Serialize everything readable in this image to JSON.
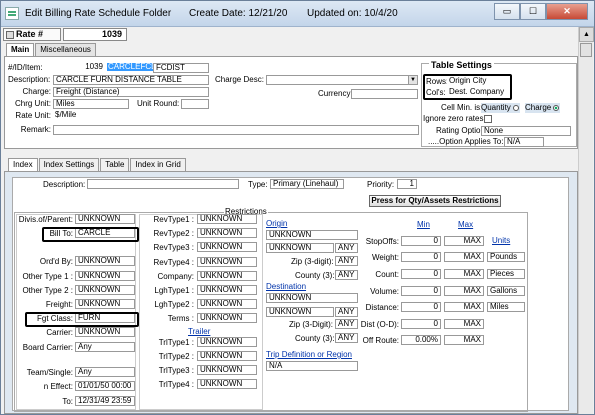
{
  "window": {
    "title": "Edit Billing Rate Schedule Folder",
    "created": "Create Date: 12/21/20",
    "updated": "Updated on: 10/4/20",
    "btn_min": "▭",
    "btn_max": "☐",
    "btn_close": "✕"
  },
  "rate": {
    "label": "Rate #",
    "value": "1039"
  },
  "top_tabs": [
    "Main",
    "Miscellaneous"
  ],
  "main": {
    "id_label": "#/ID/Item:",
    "id_num": "1039",
    "id_code": "CARCLEFCDS",
    "id_item": "FCDIST",
    "desc_label": "Description:",
    "desc_value": "CARCLE FURN DISTANCE TABLE",
    "charge_label": "Charge:",
    "charge_value": "Freight (Distance)",
    "chrg_unit_label": "Chrg Unit:",
    "chrg_unit_value": "Miles",
    "unit_round_label": "Unit Round:",
    "rate_unit_label": "Rate Unit:",
    "rate_unit_value": "$/Mile",
    "remark_label": "Remark:",
    "charge_desc_label": "Charge Desc:",
    "currency_label": "Currency:"
  },
  "table_settings": {
    "title": "Table Settings",
    "rows_label": "Rows:",
    "rows_value": "Origin City",
    "cols_label": "Col's:",
    "cols_value": "Dest. Company",
    "cell_min_label": "Cell Min. is:",
    "quantity_label": "Quantity",
    "charge_label": "Charge",
    "ignore_label": "Ignore zero rates",
    "rating_label": "Rating Option:",
    "rating_value": "None",
    "option_label": ".....Option Applies To:",
    "option_value": "N/A"
  },
  "bottom_tabs": [
    "Index",
    "Index Settings",
    "Table",
    "Index in Grid"
  ],
  "index": {
    "description_label": "Description:",
    "type_label": "Type:",
    "type_value": "Primary (Linehaul)",
    "priority_label": "Priority:",
    "priority_value": "1",
    "press_button": "Press for Qty/Assets Restrictions",
    "restrictions_label": "Restrictions",
    "left": [
      {
        "label": "Divis.of/Parent:",
        "value": "UNKNOWN"
      },
      {
        "label": "Bill To:",
        "value": "CARCLE"
      },
      {
        "label": "Ord'd By:",
        "value": "UNKNOWN"
      },
      {
        "label": "Other Type 1 :",
        "value": "UNKNOWN"
      },
      {
        "label": "Other Type 2 :",
        "value": "UNKNOWN"
      },
      {
        "label": "Freight:",
        "value": "UNKNOWN"
      },
      {
        "label": "Fgt Class:",
        "value": "FURN"
      },
      {
        "label": "Carrier:",
        "value": "UNKNOWN"
      },
      {
        "label": "Board Carrier:",
        "value": "Any"
      },
      {
        "label": "Team/Single:",
        "value": "Any"
      },
      {
        "label": "n Effect:",
        "value": "01/01/50 00:00"
      },
      {
        "label": "To:",
        "value": "12/31/49 23:59"
      }
    ],
    "rev": [
      {
        "label": "RevType1 :",
        "value": "UNKNOWN"
      },
      {
        "label": "RevType2 :",
        "value": "UNKNOWN"
      },
      {
        "label": "RevType3 :",
        "value": "UNKNOWN"
      },
      {
        "label": "RevType4 :",
        "value": "UNKNOWN"
      },
      {
        "label": "Company:",
        "value": "UNKNOWN"
      },
      {
        "label": "LghType1 :",
        "value": "UNKNOWN"
      },
      {
        "label": "LghType2 :",
        "value": "UNKNOWN"
      },
      {
        "label": "Terms :",
        "value": "UNKNOWN"
      }
    ],
    "trailer_label": "Trailer",
    "trl": [
      {
        "label": "TrlType1 :",
        "value": "UNKNOWN"
      },
      {
        "label": "TrlType2 :",
        "value": "UNKNOWN"
      },
      {
        "label": "TrlType3 :",
        "value": "UNKNOWN"
      },
      {
        "label": "TrlType4 :",
        "value": "UNKNOWN"
      }
    ],
    "origin_label": "Origin",
    "origin_v1": "UNKNOWN",
    "origin_v2": "UNKNOWN",
    "any": "ANY",
    "zip3_label": "Zip (3-digit):",
    "county3_label": "County (3):",
    "dest_label": "Destination",
    "dest_v1": "UNKNOWN",
    "dest_v2": "UNKNOWN",
    "zip3d_label": "Zip (3-Digit):",
    "countyd_label": "County (3):",
    "trip_label": "Trip Definition or Region",
    "trip_value": "N/A",
    "min_label": "Min",
    "max_label": "Max",
    "units_label": "Units",
    "rows": [
      {
        "label": "StopOffs:",
        "min": "0",
        "max": "MAX",
        "unit": ""
      },
      {
        "label": "Weight:",
        "min": "0",
        "max": "MAX",
        "unit": "Pounds"
      },
      {
        "label": "Count:",
        "min": "0",
        "max": "MAX",
        "unit": "Pieces"
      },
      {
        "label": "Volume:",
        "min": "0",
        "max": "MAX",
        "unit": "Gallons"
      },
      {
        "label": "Distance:",
        "min": "0",
        "max": "MAX",
        "unit": "Miles"
      },
      {
        "label": "Dist (O-D):",
        "min": "0",
        "max": "MAX",
        "unit": ""
      },
      {
        "label": "Off Route:",
        "min": "0.00%",
        "max": "MAX",
        "unit": ""
      }
    ]
  }
}
